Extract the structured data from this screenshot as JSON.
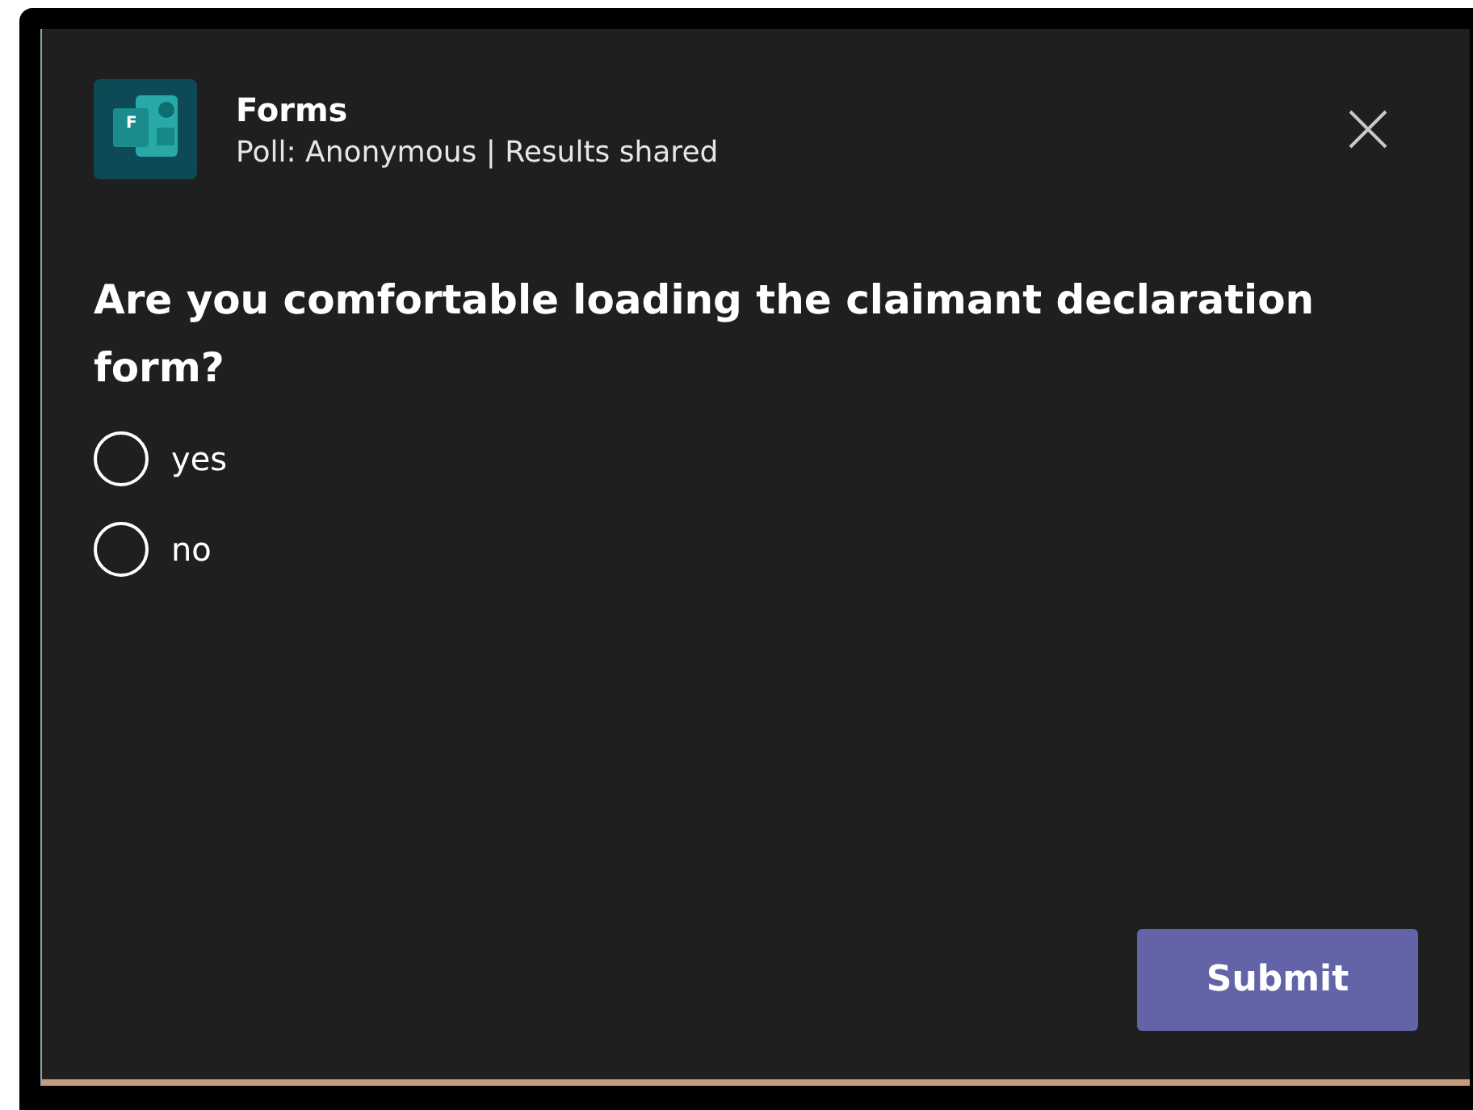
{
  "app": {
    "logo_letter": "F",
    "title": "Forms",
    "subtitle": "Poll: Anonymous | Results shared"
  },
  "question": "Are you comfortable loading the claimant declaration form?",
  "options": [
    {
      "label": "yes",
      "selected": false
    },
    {
      "label": "no",
      "selected": false
    }
  ],
  "submit": {
    "label": "Submit"
  }
}
